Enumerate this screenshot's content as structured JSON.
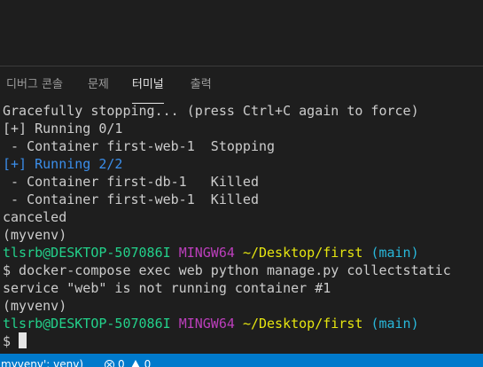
{
  "panel": {
    "tabs": [
      {
        "label": "디버그 콘솔",
        "active": false
      },
      {
        "label": "문제",
        "active": false
      },
      {
        "label": "터미널",
        "active": true
      },
      {
        "label": "출력",
        "active": false
      }
    ]
  },
  "terminal": {
    "lines": [
      [
        {
          "text": "Gracefully stopping... (press Ctrl+C again to force)",
          "color": "default"
        }
      ],
      [
        {
          "text": "[+] Running 0/1",
          "color": "default"
        }
      ],
      [
        {
          "text": " - Container first-web-1  Stopping",
          "color": "default"
        }
      ],
      [
        {
          "text": "[+] Running 2/2",
          "color": "blue"
        }
      ],
      [
        {
          "text": " - Container first-db-1   Killed",
          "color": "default"
        }
      ],
      [
        {
          "text": " - Container first-web-1  Killed",
          "color": "default"
        }
      ],
      [
        {
          "text": "canceled",
          "color": "default"
        }
      ],
      [
        {
          "text": "(myvenv)",
          "color": "default"
        }
      ],
      [
        {
          "text": "tlsrb@DESKTOP-507086I",
          "color": "green"
        },
        {
          "text": " ",
          "color": "default"
        },
        {
          "text": "MINGW64",
          "color": "magenta"
        },
        {
          "text": " ",
          "color": "default"
        },
        {
          "text": "~/Desktop/first",
          "color": "yellow"
        },
        {
          "text": " ",
          "color": "default"
        },
        {
          "text": "(main)",
          "color": "cyan"
        }
      ],
      [
        {
          "text": "$ docker-compose exec web python manage.py collectstatic",
          "color": "default"
        }
      ],
      [
        {
          "text": "service \"web\" is not running container #1",
          "color": "default"
        }
      ],
      [
        {
          "text": "(myvenv)",
          "color": "default"
        }
      ],
      [
        {
          "text": "tlsrb@DESKTOP-507086I",
          "color": "green"
        },
        {
          "text": " ",
          "color": "default"
        },
        {
          "text": "MINGW64",
          "color": "magenta"
        },
        {
          "text": " ",
          "color": "default"
        },
        {
          "text": "~/Desktop/first",
          "color": "yellow"
        },
        {
          "text": " ",
          "color": "default"
        },
        {
          "text": "(main)",
          "color": "cyan"
        }
      ]
    ],
    "prompt_symbol": "$ ",
    "colors": {
      "background": "#1e1e1e",
      "default": "#cccccc",
      "blue": "#3b8eea",
      "green": "#23d18b",
      "magenta": "#bc3fbc",
      "yellow": "#e5e510",
      "cyan": "#29b8db"
    }
  },
  "status_bar": {
    "env_label": "myvenv': venv)",
    "error_count": "0",
    "warning_count": "0",
    "background": "#007acc",
    "icons": [
      "error-icon",
      "warning-icon"
    ]
  }
}
